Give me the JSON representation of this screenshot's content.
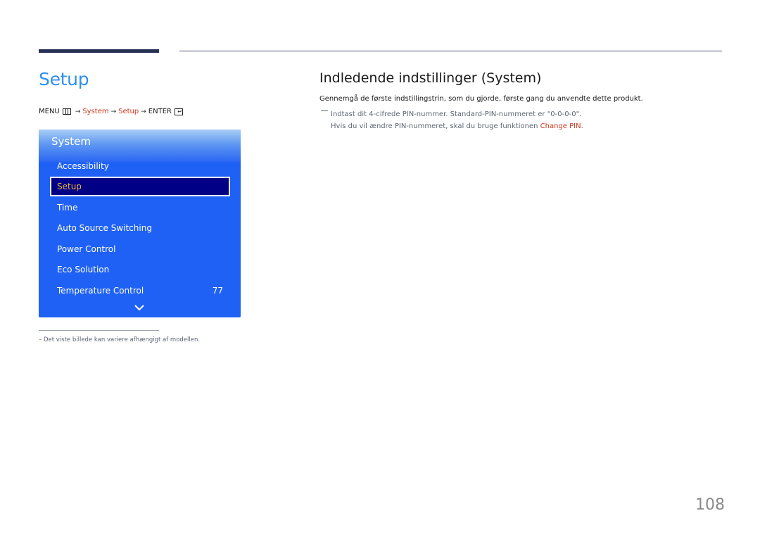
{
  "page": {
    "title": "Setup",
    "number": "108"
  },
  "breadcrumb": {
    "menu": "MENU",
    "menu_icon": "menu-icon",
    "arrow": "→",
    "system": "System",
    "setup": "Setup",
    "enter": "ENTER",
    "enter_icon": "enter-icon"
  },
  "osd": {
    "title": "System",
    "items": [
      {
        "label": "Accessibility",
        "value": "",
        "selected": false
      },
      {
        "label": "Setup",
        "value": "",
        "selected": true
      },
      {
        "label": "Time",
        "value": "",
        "selected": false
      },
      {
        "label": "Auto Source Switching",
        "value": "",
        "selected": false
      },
      {
        "label": "Power Control",
        "value": "",
        "selected": false
      },
      {
        "label": "Eco Solution",
        "value": "",
        "selected": false
      },
      {
        "label": "Temperature Control",
        "value": "77",
        "selected": false
      }
    ],
    "more_icon": "chevron-down-icon",
    "colors": {
      "panel": "#1f61f5",
      "selected_bg": "#000087",
      "selected_text": "#f0b33c"
    }
  },
  "footnote": "–  Det viste billede kan variere afhængigt af modellen.",
  "section": {
    "title": "Indledende indstillinger (System)",
    "description": "Gennemgå de første indstillingstrin, som du gjorde, første gang du anvendte dette produkt.",
    "note_line1": "Indtast dit 4-cifrede PIN-nummer. Standard-PIN-nummeret er \"0-0-0-0\".",
    "note_line2_prefix": "Hvis du vil ændre PIN-nummeret, skal du bruge funktionen ",
    "note_line2_link": "Change PIN",
    "note_line2_suffix": "."
  },
  "colors": {
    "title_blue": "#2e8ff0",
    "accent_red": "#d1361c",
    "rule_dark": "#262f54"
  }
}
